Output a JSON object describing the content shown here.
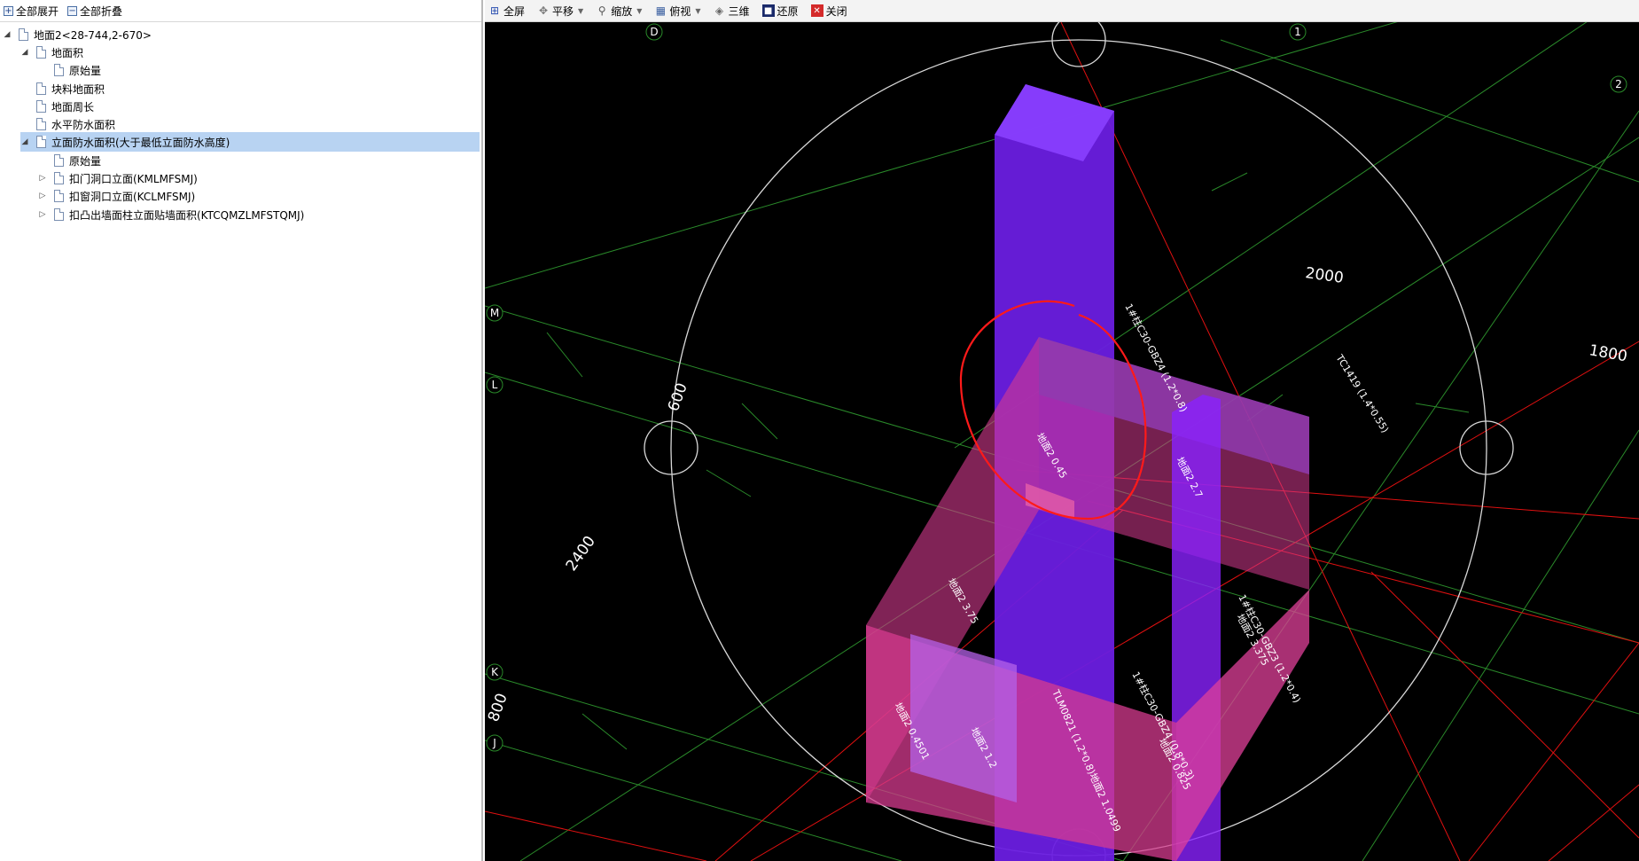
{
  "left_toolbar": {
    "expand_all": "全部展开",
    "collapse_all": "全部折叠"
  },
  "tree": {
    "root": "地面2<28-744,2-670>",
    "items": [
      {
        "label": "地面积"
      },
      {
        "label": "原始量"
      },
      {
        "label": "块料地面积"
      },
      {
        "label": "地面周长"
      },
      {
        "label": "水平防水面积"
      },
      {
        "label": "立面防水面积(大于最低立面防水高度)"
      },
      {
        "label": "原始量"
      },
      {
        "label": "扣门洞口立面(KMLMFSMJ)"
      },
      {
        "label": "扣窗洞口立面(KCLMFSMJ)"
      },
      {
        "label": "扣凸出墙面柱立面贴墙面积(KTCQMZLMFSTQMJ)"
      }
    ]
  },
  "viewport_toolbar": {
    "fullscreen": "全屏",
    "pan": "平移",
    "zoom": "缩放",
    "top_view": "俯视",
    "three_d": "三维",
    "restore": "还原",
    "close": "关闭"
  },
  "viewport": {
    "axis_labels": {
      "D": "D",
      "one": "1",
      "two": "2",
      "M": "M",
      "L": "L",
      "K": "K",
      "J": "J"
    },
    "dimensions": {
      "d2000": "2000",
      "d1800": "1800",
      "d600": "600",
      "d2400": "2400",
      "d800": "800"
    },
    "element_labels": {
      "col_gbz4": "1#柱C30-GBZ4 (1.2*0.8)",
      "tc1419": "TC1419 (1.4*0.55)",
      "floor_045": "地面2 0.45",
      "floor_27": "地面2 2.7",
      "floor_375": "地面2 3.75",
      "col_gbz3": "1#柱C30-GBZ3 (1.2*0.4)",
      "floor_3375": "地面2 3.375",
      "col_gbz4_small": "1#柱C30-GBZ4 (0.8*0.3)",
      "floor_0825": "地面2 0.825",
      "floor_04501": "地面2 0.4501",
      "floor_12": "地面2 1.2",
      "tlm0821": "TLM0821 (1.2*0.8)地面2 1.0499"
    },
    "colors": {
      "background": "#000000",
      "purple": "#7a2cff",
      "magenta": "#d63b8f",
      "blue": "#3b3bd6",
      "red_line": "#e01010",
      "green_line": "#2a8a2a",
      "circle": "#d9d9d9",
      "annotation": "#ff1a1a"
    }
  }
}
